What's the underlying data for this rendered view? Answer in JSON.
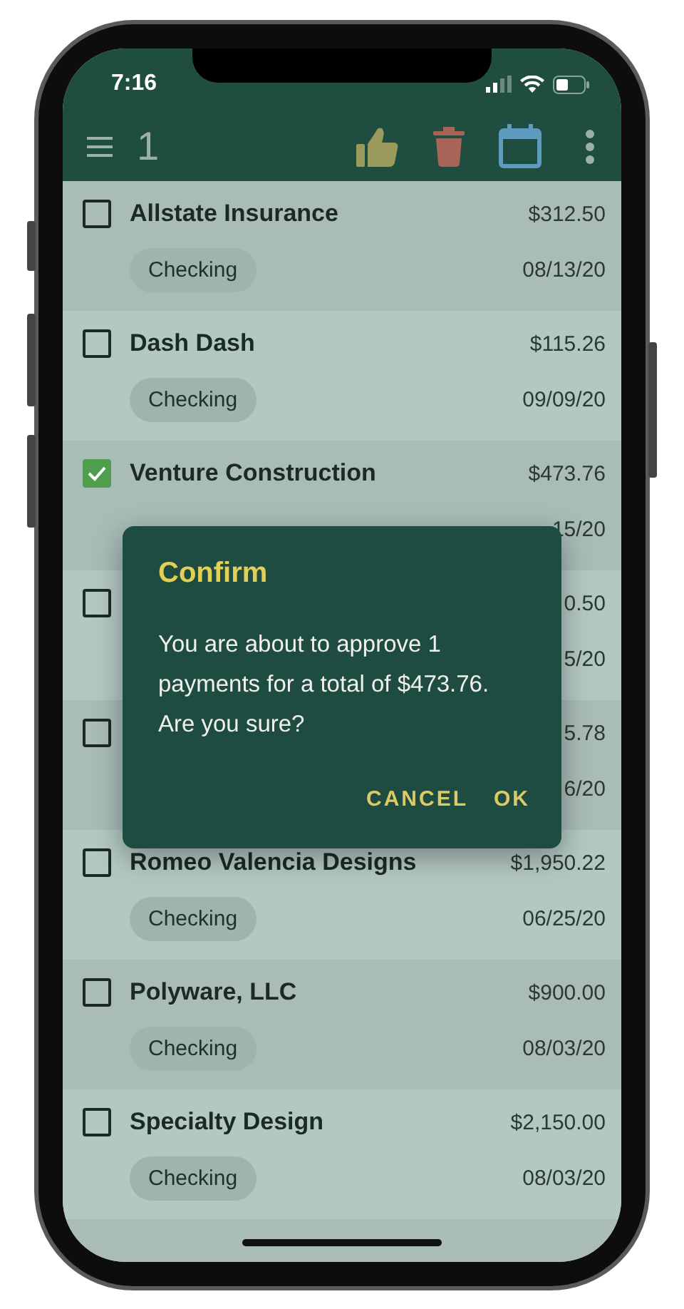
{
  "status_bar": {
    "time": "7:16"
  },
  "toolbar": {
    "selected_count": "1"
  },
  "payments": [
    {
      "selected": false,
      "payee": "Allstate Insurance",
      "amount": "$312.50",
      "account": "Checking",
      "date": "08/13/20"
    },
    {
      "selected": false,
      "payee": "Dash Dash",
      "amount": "$115.26",
      "account": "Checking",
      "date": "09/09/20"
    },
    {
      "selected": true,
      "payee": "Venture Construction",
      "amount": "$473.76",
      "date": "15/20"
    },
    {
      "selected": false,
      "amount": "0.50",
      "date": "5/20"
    },
    {
      "selected": false,
      "amount": "5.78",
      "date": "6/20"
    },
    {
      "selected": false,
      "payee": "Romeo Valencia Designs",
      "amount": "$1,950.22",
      "account": "Checking",
      "date": "06/25/20"
    },
    {
      "selected": false,
      "payee": "Polyware, LLC",
      "amount": "$900.00",
      "account": "Checking",
      "date": "08/03/20"
    },
    {
      "selected": false,
      "payee": "Specialty Design",
      "amount": "$2,150.00",
      "account": "Checking",
      "date": "08/03/20"
    }
  ],
  "dialog": {
    "title": "Confirm",
    "message": "You are about to approve 1 payments for a total of $473.76. Are you sure?",
    "actions": [
      "CANCEL",
      "OK"
    ]
  }
}
